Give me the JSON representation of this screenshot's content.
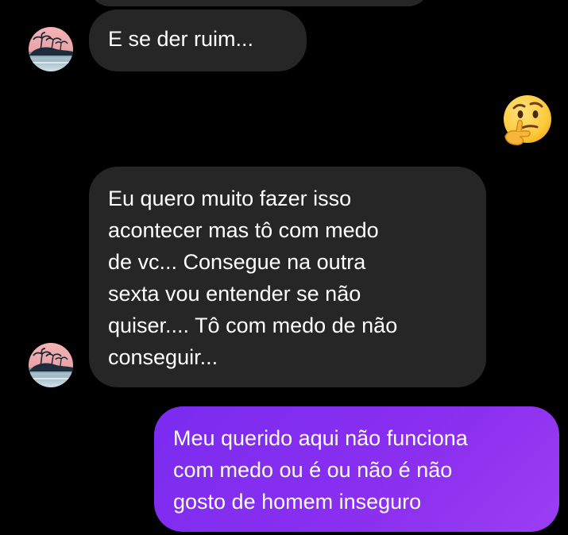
{
  "chat": {
    "messages": [
      {
        "sender": "them",
        "text": ""
      },
      {
        "sender": "them",
        "text": "E se  der ruim..."
      },
      {
        "sender": "me",
        "emoji": "thinking-face"
      },
      {
        "sender": "them",
        "text": "Eu quero muito fazer isso\nacontecer mas tô com medo\nde vc...  Consegue na outra\nsexta vou entender se não\nquiser....  Tô com medo de não\nconseguir..."
      },
      {
        "sender": "me",
        "text": "Meu querido aqui não funciona\ncom medo ou é ou não é não\ngosto de homem inseguro"
      }
    ],
    "colors": {
      "background": "#000000",
      "incoming_bubble": "#262626",
      "outgoing_bubble": "#8a2ff0",
      "text": "#ffffff"
    },
    "avatar_icon": "beach-palm-avatar"
  }
}
